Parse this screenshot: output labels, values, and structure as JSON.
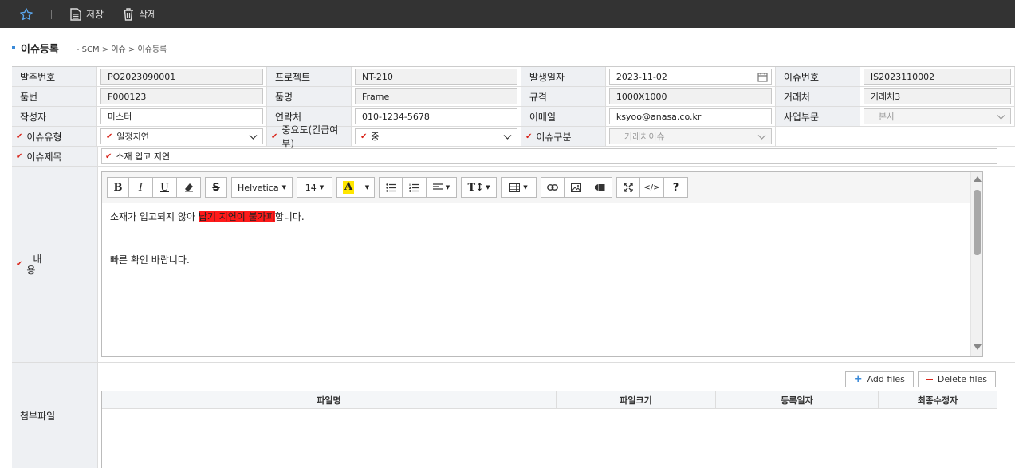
{
  "toolbar": {
    "save_label": "저장",
    "delete_label": "삭제"
  },
  "page": {
    "title": "이슈등록",
    "breadcrumb": "- SCM > 이슈 > 이슈등록"
  },
  "form": {
    "row1": {
      "l1": "발주번호",
      "v1": "PO2023090001",
      "l2": "프로젝트",
      "v2": "NT-210",
      "l3": "발생일자",
      "v3": "2023-11-02",
      "l4": "이슈번호",
      "v4": "IS2023110002"
    },
    "row2": {
      "l1": "품번",
      "v1": "F000123",
      "l2": "품명",
      "v2": "Frame",
      "l3": "규격",
      "v3": "1000X1000",
      "l4": "거래처",
      "v4": "거래처3"
    },
    "row3": {
      "l1": "작성자",
      "v1": "마스터",
      "l2": "연락처",
      "v2": "010-1234-5678",
      "l3": "이메일",
      "v3": "ksyoo@anasa.co.kr",
      "l4": "사업부문",
      "v4": "본사"
    },
    "row4": {
      "l1": "이슈유형",
      "v1": "일정지연",
      "l2": "중요도(긴급여부)",
      "v2": "중",
      "l3": "이슈구분",
      "v3": "거래처이슈"
    },
    "row5": {
      "l1": "이슈제목",
      "v1": "소재 입고 지연"
    },
    "content": {
      "label_1": "내",
      "label_2": "용",
      "line1_pre": "소재가 입고되지 않아 ",
      "line1_hl": "납기 지연이 불가피",
      "line1_post": "합니다.",
      "line2": "빠른 확인 바랍니다."
    },
    "editor": {
      "font_name": "Helvetica",
      "font_size": "14"
    },
    "files": {
      "label": "첨부파일",
      "add_label": "Add files",
      "delete_label": "Delete files",
      "columns": [
        "파일명",
        "파일크기",
        "등록일자",
        "최종수정자"
      ]
    }
  },
  "colors": {
    "accent": "#3a8ad8",
    "required": "#d9261c",
    "highlight": "#ff1a1a",
    "topbar": "#333333"
  }
}
